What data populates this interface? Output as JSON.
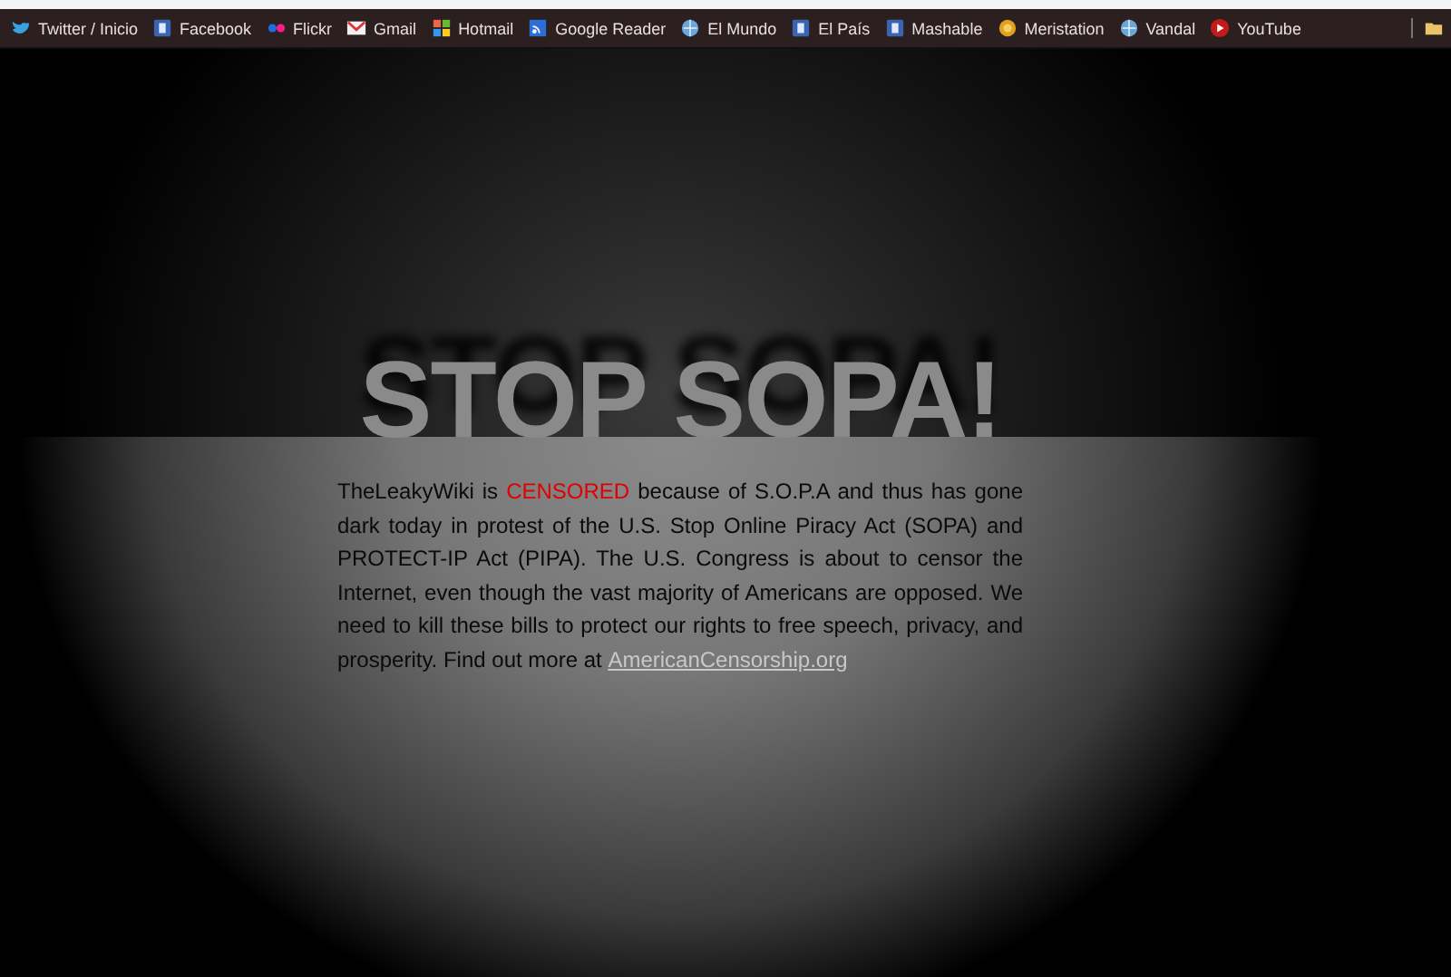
{
  "bookmarks": [
    {
      "label": "Twitter / Inicio",
      "kind": "bird"
    },
    {
      "label": "Facebook",
      "kind": "square"
    },
    {
      "label": "Flickr",
      "kind": "dots"
    },
    {
      "label": "Gmail",
      "kind": "envelope"
    },
    {
      "label": "Hotmail",
      "kind": "flag"
    },
    {
      "label": "Google Reader",
      "kind": "feed"
    },
    {
      "label": "El Mundo",
      "kind": "globe"
    },
    {
      "label": "El País",
      "kind": "square"
    },
    {
      "label": "Mashable",
      "kind": "square"
    },
    {
      "label": "Meristation",
      "kind": "coin"
    },
    {
      "label": "Vandal",
      "kind": "globe"
    },
    {
      "label": "YouTube",
      "kind": "play"
    }
  ],
  "headline": "STOP SOPA!",
  "message": {
    "parts": [
      {
        "text": "TheLeakyWiki is ",
        "kind": "plain"
      },
      {
        "text": "CENSORED",
        "kind": "alert"
      },
      {
        "text": " because of S.O.P.A and thus has gone dark today in protest of the U.S. Stop Online Piracy Act (SOPA) and PROTECT-IP Act (PIPA). The U.S. Congress is about to censor the Internet, even though the vast majority of Americans are opposed. We need to kill these bills to protect our rights to free speech, privacy, and prosperity. Find out more at ",
        "kind": "plain"
      }
    ],
    "link": "AmericanCensorship.org"
  }
}
